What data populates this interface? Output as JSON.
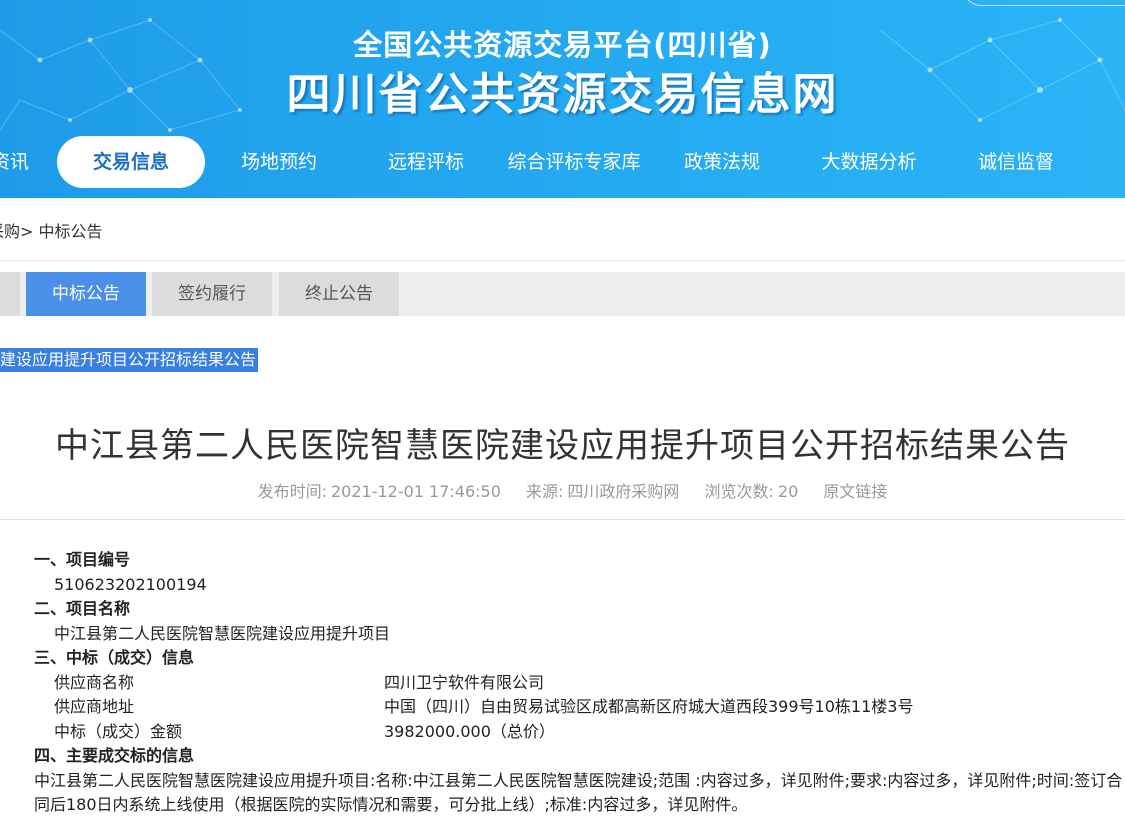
{
  "header": {
    "subtitle": "全国公共资源交易平台(四川省)",
    "title": "四川省公共资源交易信息网"
  },
  "nav": {
    "items": [
      {
        "label": "资讯"
      },
      {
        "label": "交易信息"
      },
      {
        "label": "场地预约"
      },
      {
        "label": "远程评标"
      },
      {
        "label": "综合评标专家库"
      },
      {
        "label": "政策法规"
      },
      {
        "label": "大数据分析"
      },
      {
        "label": "诚信监督"
      }
    ]
  },
  "breadcrumb": {
    "prev": "采购>",
    "current": "中标公告"
  },
  "tabs": [
    {
      "label": "中标公告"
    },
    {
      "label": "签约履行"
    },
    {
      "label": "终止公告"
    }
  ],
  "highlight_link": "建设应用提升项目公开招标结果公告",
  "article": {
    "title": "中江县第二人民医院智慧医院建设应用提升项目公开招标结果公告",
    "publish_label": "发布时间:",
    "publish_time": "2021-12-01 17:46:50",
    "source_label": "来源:",
    "source": "四川政府采购网",
    "views_label": "浏览次数:",
    "views": "20",
    "original_link": "原文链接"
  },
  "content": {
    "s1_title": "一、项目编号",
    "s1_value": "510623202100194",
    "s2_title": "二、项目名称",
    "s2_value": "中江县第二人民医院智慧医院建设应用提升项目",
    "s3_title": "三、中标（成交）信息",
    "supplier_name_label": "供应商名称",
    "supplier_name": "四川卫宁软件有限公司",
    "supplier_addr_label": "供应商地址",
    "supplier_addr": "中国（四川）自由贸易试验区成都高新区府城大道西段399号10栋11楼3号",
    "amount_label": "中标（成交）金额",
    "amount": "3982000.000（总价）",
    "s4_title": "四、主要成交标的信息",
    "s4_text": "中江县第二人民医院智慧医院建设应用提升项目:名称:中江县第二人民医院智慧医院建设;范围 :内容过多，详见附件;要求:内容过多，详见附件;时间:签订合同后180日内系统上线使用（根据医院的实际情况和需要，可分批上线）;标准:内容过多，详见附件。"
  },
  "colors": {
    "banner": "#23a8f0",
    "active_tab": "#4a8fe8",
    "nav_active_text": "#1f6fc0"
  }
}
